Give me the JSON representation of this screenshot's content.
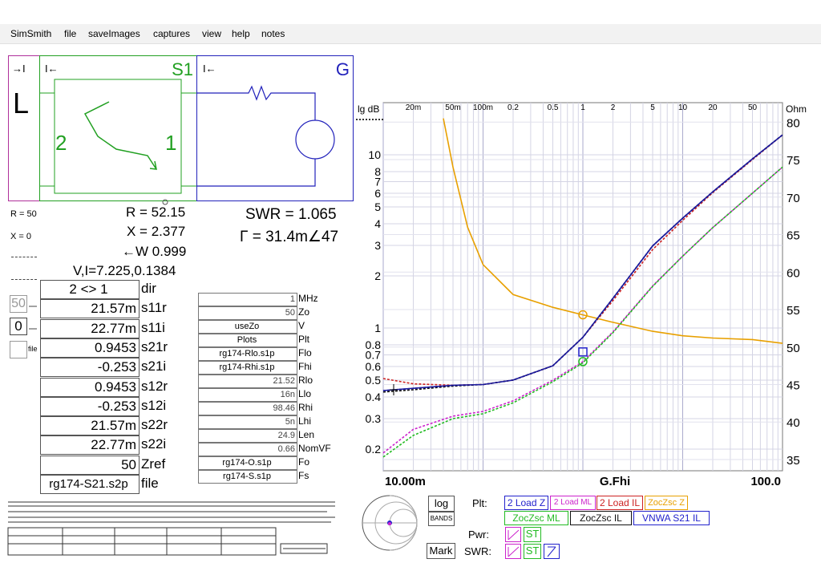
{
  "menu": [
    "SimSmith",
    "file",
    "saveImages",
    "captures",
    "view",
    "help",
    "notes"
  ],
  "schematic": {
    "load_label": "L",
    "s1_label": "S1",
    "s1_port2": "2",
    "s1_port1": "1",
    "gen_label": "G",
    "arrow_right": "→I",
    "arrow_left": "I←"
  },
  "load_side": {
    "r": "R = 50",
    "x": "X = 0",
    "r_input": "50",
    "x_input": "0",
    "units": "file"
  },
  "results": {
    "r": "R = 52.15",
    "x": "X = 2.377",
    "w": "←W 0.999",
    "vi": "V,I=7.225,0.1384",
    "swr": "SWR = 1.065",
    "gamma": "Γ = 31.4m∠47"
  },
  "sparams": [
    {
      "value": "2 <> 1",
      "label": "dir"
    },
    {
      "value": "21.57m",
      "label": "s11r"
    },
    {
      "value": "22.77m",
      "label": "s11i"
    },
    {
      "value": "0.9453",
      "label": "s21r"
    },
    {
      "value": "-0.253",
      "label": "s21i"
    },
    {
      "value": "0.9453",
      "label": "s12r"
    },
    {
      "value": "-0.253",
      "label": "s12i"
    },
    {
      "value": "21.57m",
      "label": "s22r"
    },
    {
      "value": "22.77m",
      "label": "s22i"
    },
    {
      "value": "50",
      "label": "Zref"
    },
    {
      "value": "rg174-S21.s2p",
      "label": "file"
    }
  ],
  "params": [
    {
      "value": "1",
      "label": "MHz"
    },
    {
      "value": "50",
      "label": "Zo"
    },
    {
      "value": "useZo",
      "label": "V"
    },
    {
      "value": "Plots",
      "label": "Plt"
    },
    {
      "value": "rg174-Rlo.s1p",
      "label": "Flo"
    },
    {
      "value": "rg174-Rhi.s1p",
      "label": "Fhi"
    },
    {
      "value": "21.52",
      "label": "Rlo"
    },
    {
      "value": "16n",
      "label": "Llo"
    },
    {
      "value": "98.46",
      "label": "Rhi"
    },
    {
      "value": "5n",
      "label": "Lhi"
    },
    {
      "value": "24.9",
      "label": "Len"
    },
    {
      "value": "0.66",
      "label": "NomVF"
    },
    {
      "value": "rg174-O.s1p",
      "label": "Fo"
    },
    {
      "value": "rg174-S.s1p",
      "label": "Fs"
    }
  ],
  "chart_data": {
    "type": "line",
    "title": "",
    "xlabel": "G.Fhi",
    "x_start_label": "10.00m",
    "x_end_label": "100.0",
    "x_scale": "log",
    "xlim": [
      0.01,
      100
    ],
    "top_ticks": [
      "20m",
      "50m",
      "100m",
      "0.2",
      "0.5",
      "1",
      "2",
      "5",
      "10",
      "20",
      "50"
    ],
    "y_left_label": "lg dB",
    "y_left_scale": "log",
    "y_left_ticks": [
      "10",
      "8",
      "7",
      "6",
      "5",
      "4",
      "3",
      "2",
      "1",
      "0.8",
      "0.7",
      "0.6",
      "0.5",
      "0.4",
      "0.3",
      "0.2"
    ],
    "y_right_label": "Ohm",
    "y_right_ticks": [
      "80",
      "75",
      "70",
      "65",
      "60",
      "55",
      "50",
      "45",
      "40",
      "35"
    ],
    "y_right_range": [
      35,
      80
    ],
    "grid": true,
    "series": [
      {
        "name": "2 Load Z",
        "color": "#1a1aa0",
        "axis": "right",
        "x": [
          0.01,
          0.02,
          0.05,
          0.1,
          0.2,
          0.5,
          1,
          2,
          5,
          10,
          20,
          50,
          100
        ],
        "y": [
          44.2,
          44.5,
          44.9,
          45.0,
          45.6,
          47.5,
          51.3,
          56.5,
          63.5,
          67.2,
          70.7,
          75.1,
          78.3
        ]
      },
      {
        "name": "2 Load ML",
        "color": "#cc22cc",
        "axis": "left",
        "x": [
          0.01,
          0.02,
          0.05,
          0.1,
          0.2,
          0.5,
          1,
          2,
          5,
          10,
          20,
          50,
          100
        ],
        "y": [
          0.19,
          0.26,
          0.31,
          0.33,
          0.38,
          0.5,
          0.64,
          0.95,
          1.75,
          2.6,
          3.8,
          6.0,
          8.5
        ]
      },
      {
        "name": "2 Load IL",
        "color": "#cc2222",
        "axis": "right",
        "x": [
          0.01,
          0.02,
          0.05,
          0.1,
          0.2,
          0.5,
          1,
          2,
          5,
          10,
          20,
          50,
          100
        ],
        "y": [
          45.8,
          45.1,
          44.9,
          45.0,
          45.6,
          47.5,
          51.3,
          56.2,
          63.0,
          66.9,
          70.6,
          75.0,
          78.3
        ]
      },
      {
        "name": "ZocZsc Z",
        "color": "#e8a000",
        "axis": "right",
        "x": [
          0.04,
          0.05,
          0.07,
          0.1,
          0.2,
          0.5,
          1,
          2,
          5,
          10,
          20,
          50,
          100
        ],
        "y": [
          80.5,
          74.0,
          66.0,
          61.0,
          57.0,
          55.3,
          54.3,
          53.3,
          52.1,
          51.5,
          51.2,
          51.0,
          50.5
        ]
      },
      {
        "name": "ZocZsc ML",
        "color": "#22bb22",
        "axis": "left",
        "x": [
          0.01,
          0.02,
          0.05,
          0.1,
          0.2,
          0.5,
          1,
          2,
          5,
          10,
          20,
          50,
          100
        ],
        "y": [
          0.18,
          0.24,
          0.3,
          0.32,
          0.37,
          0.49,
          0.63,
          0.94,
          1.74,
          2.6,
          3.8,
          6.0,
          8.5
        ]
      },
      {
        "name": "ZocZsc IL",
        "color": "#111111",
        "axis": "right",
        "x": [
          0.01,
          0.02,
          0.05,
          0.1,
          0.2,
          0.5,
          1,
          2,
          5,
          10,
          20,
          50,
          100
        ],
        "y": [
          44.0,
          44.3,
          44.8,
          45.0,
          45.6,
          47.5,
          51.3,
          56.5,
          63.5,
          67.2,
          70.7,
          75.1,
          78.3
        ]
      },
      {
        "name": "VNWA S21 IL",
        "color": "#1a1aa0",
        "axis": "right",
        "x": [
          0.01,
          0.02,
          0.05,
          0.1,
          0.2,
          0.5,
          1,
          2,
          5,
          10,
          20,
          50,
          100
        ],
        "y": [
          44.2,
          44.5,
          44.9,
          45.0,
          45.6,
          47.5,
          51.3,
          56.5,
          63.5,
          67.2,
          70.7,
          75.1,
          78.3
        ]
      }
    ]
  },
  "controls": {
    "log": "log",
    "bands": "BANDS",
    "mark": "Mark",
    "plt": "Plt:",
    "pwr": "Pwr:",
    "swr": "SWR:",
    "toggle_st": "ST",
    "legend_buttons": [
      {
        "label": "2 Load Z",
        "color": "#2222cc"
      },
      {
        "label": "2 Load ML",
        "color": "#cc22cc"
      },
      {
        "label": "2 Load IL",
        "color": "#cc2222"
      },
      {
        "label": "ZocZsc Z",
        "color": "#e8a000"
      },
      {
        "label": "ZocZsc ML",
        "color": "#22bb22"
      },
      {
        "label": "ZocZsc IL",
        "color": "#111111"
      },
      {
        "label": "VNWA S21 IL",
        "color": "#2222cc"
      }
    ]
  },
  "colors": {
    "load": "#b0309b",
    "s1": "#22a022",
    "gen": "#2222bb"
  }
}
